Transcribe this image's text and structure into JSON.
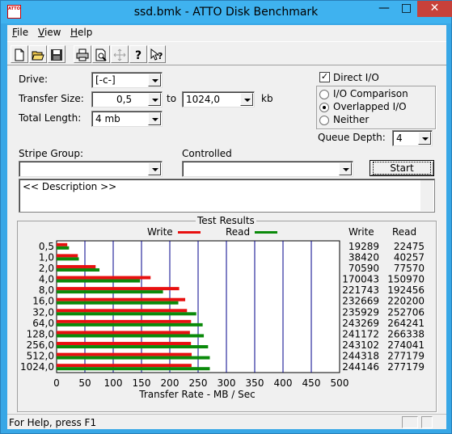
{
  "window": {
    "title": "ssd.bmk - ATTO Disk Benchmark",
    "icon_text": "ATTO"
  },
  "menu": [
    "File",
    "View",
    "Help"
  ],
  "menu_mnemonics": [
    "F",
    "V",
    "H"
  ],
  "toolbar": [
    "new-icon",
    "open-icon",
    "save-icon",
    "print-icon",
    "print-preview-icon",
    "move-icon",
    "help-icon",
    "context-help-icon"
  ],
  "form": {
    "drive_label": "Drive:",
    "drive_value": "[-c-]",
    "transfer_size_label": "Transfer Size:",
    "transfer_from": "0,5",
    "to_label": "to",
    "transfer_to": "1024,0",
    "kb_label": "kb",
    "total_length_label": "Total Length:",
    "total_length_value": "4 mb",
    "direct_io_label": "Direct I/O",
    "direct_io_checked": true,
    "io_comparison_label": "I/O Comparison",
    "overlapped_io_label": "Overlapped I/O",
    "neither_label": "Neither",
    "io_mode_selected": "Overlapped I/O",
    "queue_depth_label": "Queue Depth:",
    "queue_depth_value": "4",
    "stripe_group_label": "Stripe Group:",
    "stripe_group_value": "",
    "controlled_label": "Controlled",
    "controlled_value": "",
    "start_label": "Start",
    "description": "<< Description >>"
  },
  "results": {
    "title": "Test Results",
    "write_label": "Write",
    "read_label": "Read",
    "write_col_header": "Write",
    "read_col_header": "Read",
    "xlabel": "Transfer Rate - MB / Sec"
  },
  "colors": {
    "write": "#e81010",
    "read": "#0a8a0a",
    "grid": "#00008b"
  },
  "chart_data": {
    "type": "bar",
    "orientation": "horizontal",
    "categories": [
      "0,5",
      "1,0",
      "2,0",
      "4,0",
      "8,0",
      "16,0",
      "32,0",
      "64,0",
      "128,0",
      "256,0",
      "512,0",
      "1024,0"
    ],
    "series": [
      {
        "name": "Write",
        "values": [
          19289,
          38420,
          70590,
          170043,
          221743,
          232669,
          235929,
          243269,
          241172,
          243102,
          244318,
          244146
        ]
      },
      {
        "name": "Read",
        "values": [
          22475,
          40257,
          77570,
          150970,
          192456,
          220200,
          252706,
          264241,
          266338,
          274041,
          277179,
          277179
        ]
      }
    ],
    "write_values_text": [
      "19289",
      "38420",
      "70590",
      "170043",
      "221743",
      "232669",
      "235929",
      "243269",
      "241172",
      "243102",
      "244318",
      "244146"
    ],
    "read_values_text": [
      "22475",
      "40257",
      "77570",
      "150970",
      "192456",
      "220200",
      "252706",
      "264241",
      "266338",
      "274041",
      "277179",
      "277179"
    ],
    "xticks": [
      "0",
      "50",
      "100",
      "150",
      "200",
      "250",
      "300",
      "350",
      "400",
      "450",
      "500"
    ],
    "xlim": [
      0,
      500
    ],
    "xlabel": "Transfer Rate - MB / Sec",
    "unit_divisor": 1024,
    "grid": true
  },
  "status": {
    "text": "For Help, press F1"
  }
}
